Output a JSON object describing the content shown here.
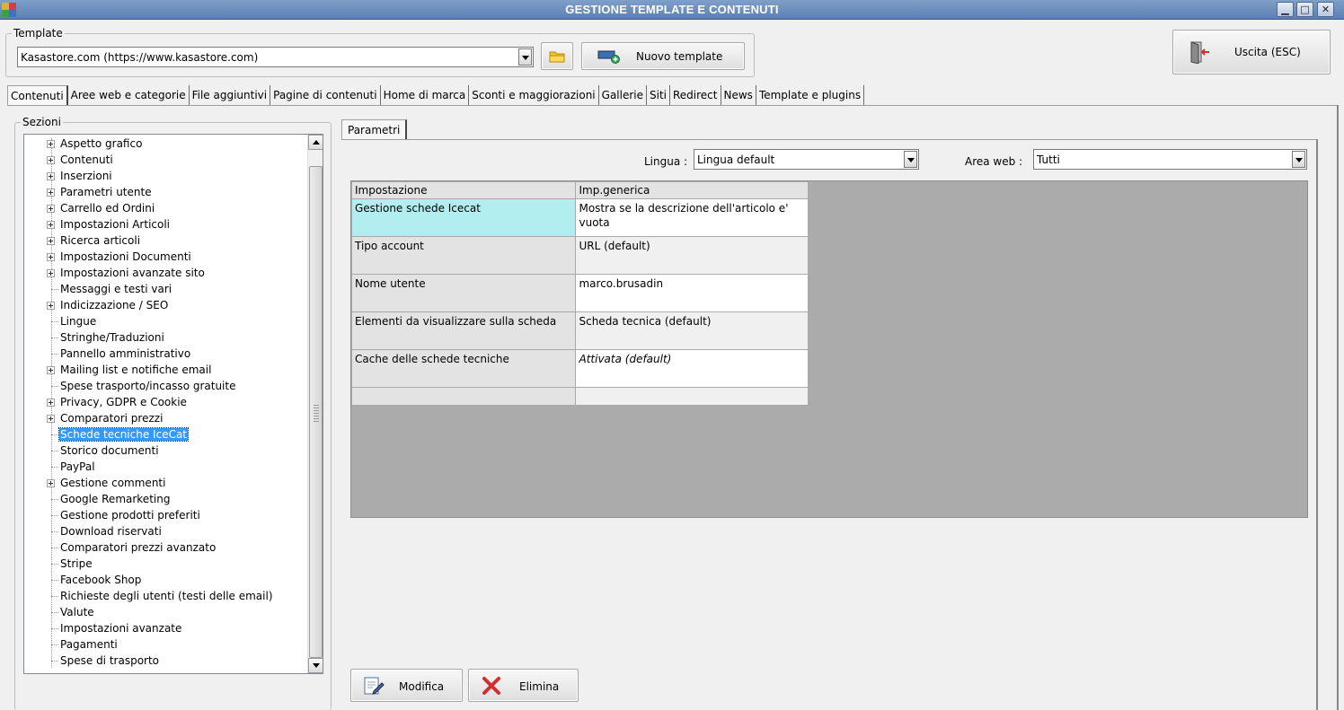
{
  "window": {
    "title": "GESTIONE TEMPLATE E CONTENUTI"
  },
  "template_group": {
    "legend": "Template",
    "selected": "Kasastore.com (https://www.kasastore.com)",
    "new_template_label": "Nuovo template"
  },
  "exit_button": {
    "label": "Uscita (ESC)"
  },
  "tabs": [
    "Contenuti",
    "Aree web e categorie",
    "File aggiuntivi",
    "Pagine di contenuti",
    "Home di marca",
    "Sconti e maggiorazioni",
    "Gallerie",
    "Siti",
    "Redirect",
    "News",
    "Template e plugins"
  ],
  "sezioni": {
    "legend": "Sezioni",
    "items": [
      {
        "label": "Aspetto grafico",
        "expandable": true
      },
      {
        "label": "Contenuti",
        "expandable": true
      },
      {
        "label": "Inserzioni",
        "expandable": true
      },
      {
        "label": "Parametri utente",
        "expandable": true
      },
      {
        "label": "Carrello ed Ordini",
        "expandable": true
      },
      {
        "label": "Impostazioni Articoli",
        "expandable": true
      },
      {
        "label": "Ricerca articoli",
        "expandable": true
      },
      {
        "label": "Impostazioni Documenti",
        "expandable": true
      },
      {
        "label": "Impostazioni avanzate sito",
        "expandable": true
      },
      {
        "label": "Messaggi e testi vari",
        "expandable": false
      },
      {
        "label": "Indicizzazione / SEO",
        "expandable": true
      },
      {
        "label": "Lingue",
        "expandable": false
      },
      {
        "label": "Stringhe/Traduzioni",
        "expandable": false
      },
      {
        "label": "Pannello amministrativo",
        "expandable": false
      },
      {
        "label": "Mailing list e notifiche email",
        "expandable": true
      },
      {
        "label": "Spese trasporto/incasso gratuite",
        "expandable": false
      },
      {
        "label": "Privacy, GDPR e Cookie",
        "expandable": true
      },
      {
        "label": "Comparatori prezzi",
        "expandable": true
      },
      {
        "label": "Schede tecniche IceCat",
        "expandable": false,
        "selected": true
      },
      {
        "label": "Storico documenti",
        "expandable": false
      },
      {
        "label": "PayPal",
        "expandable": false
      },
      {
        "label": "Gestione commenti",
        "expandable": true
      },
      {
        "label": "Google Remarketing",
        "expandable": false
      },
      {
        "label": "Gestione prodotti preferiti",
        "expandable": false
      },
      {
        "label": "Download riservati",
        "expandable": false
      },
      {
        "label": "Comparatori prezzi avanzato",
        "expandable": false
      },
      {
        "label": "Stripe",
        "expandable": false
      },
      {
        "label": "Facebook Shop",
        "expandable": false
      },
      {
        "label": "Richieste degli utenti (testi delle email)",
        "expandable": false
      },
      {
        "label": "Valute",
        "expandable": false
      },
      {
        "label": "Impostazioni avanzate",
        "expandable": false
      },
      {
        "label": "Pagamenti",
        "expandable": false
      },
      {
        "label": "Spese di trasporto",
        "expandable": false
      }
    ]
  },
  "parametri": {
    "tab_label": "Parametri",
    "lingua_label": "Lingua :",
    "lingua_value": "Lingua default",
    "area_web_label": "Area web :",
    "area_web_value": "Tutti",
    "columns": [
      "Impostazione",
      "Imp.generica"
    ],
    "rows": [
      {
        "setting": "Gestione schede Icecat",
        "value": "Mostra se la descrizione dell'articolo e' vuota",
        "selected": true
      },
      {
        "setting": "Tipo account",
        "value": "URL (default)"
      },
      {
        "setting": "Nome utente",
        "value": "marco.brusadin"
      },
      {
        "setting": "Elementi da visualizzare sulla scheda",
        "value": "Scheda tecnica (default)"
      },
      {
        "setting": "Cache delle schede tecniche",
        "value": "Attivata (default)",
        "italic": true
      }
    ]
  },
  "actions": {
    "modifica": "Modifica",
    "elimina": "Elimina"
  },
  "colors": {
    "titlebar": "#6a8dbd",
    "selection": "#3399ff",
    "selected_cell": "#b2eef0",
    "grid_bg": "#ababab"
  }
}
